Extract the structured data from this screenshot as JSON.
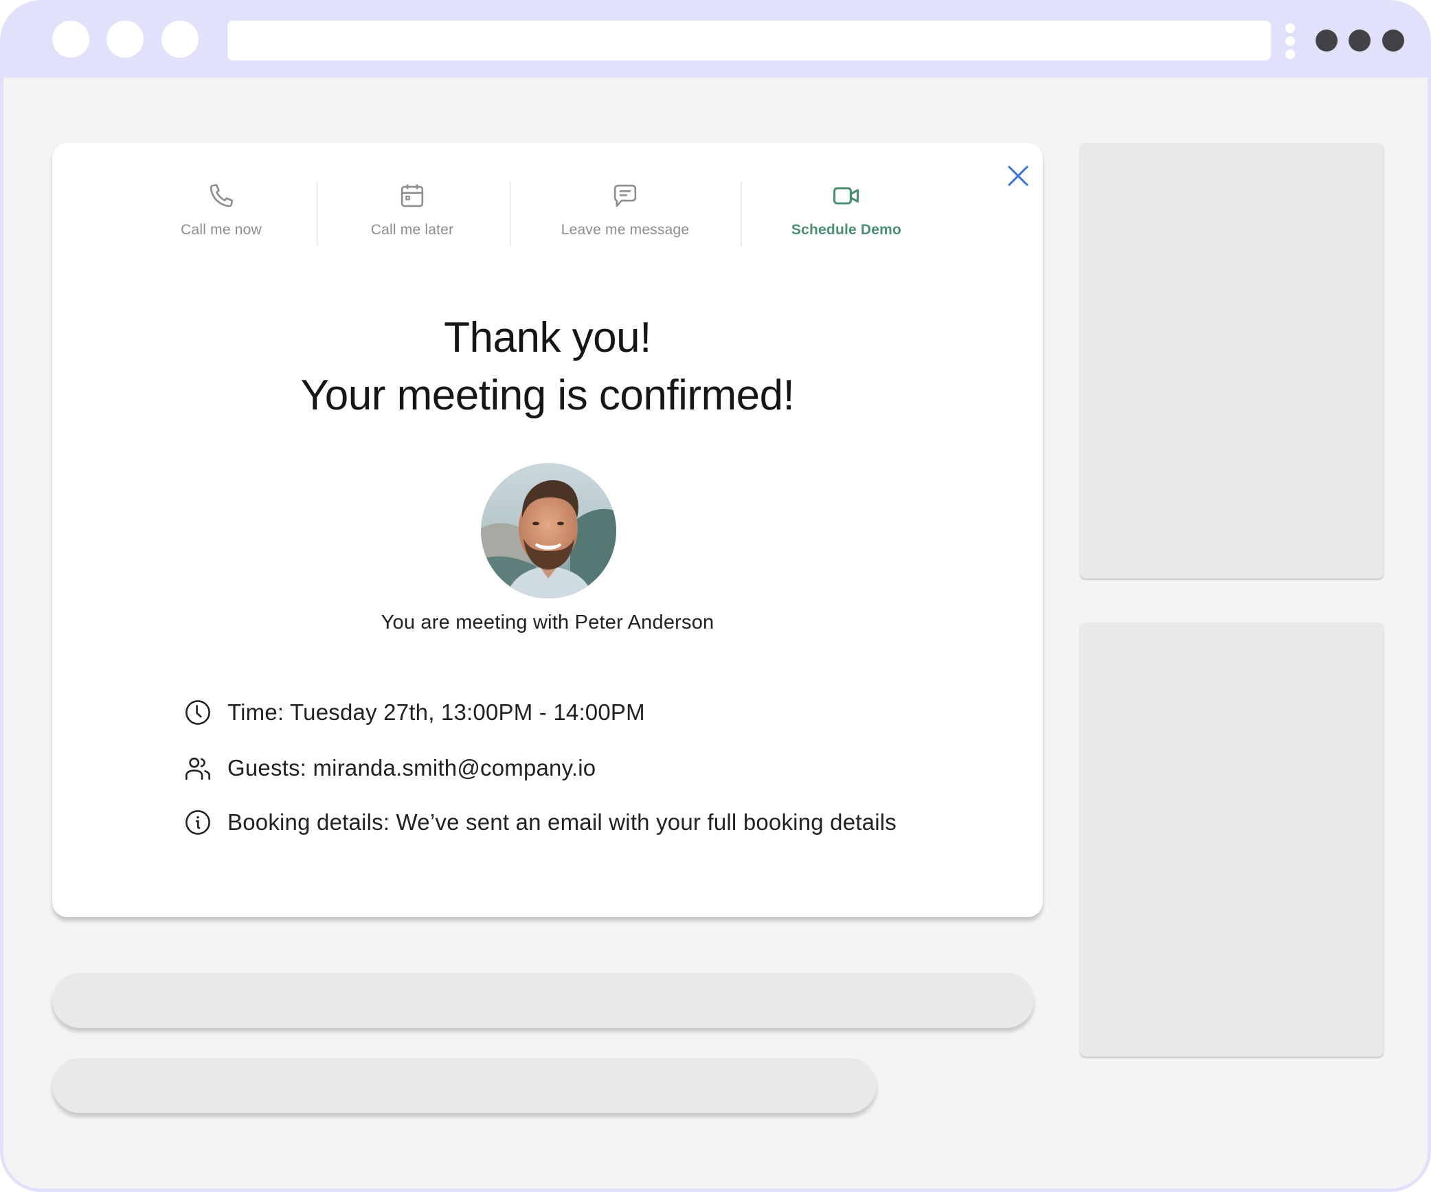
{
  "browser": {
    "window_controls": [
      "window-dot",
      "window-dot",
      "window-dot"
    ],
    "url_bar": {
      "value": "",
      "placeholder": ""
    },
    "menu_icon": "more-horizontal-icon",
    "kebab_icon": "more-vertical-icon"
  },
  "modal": {
    "close_icon": "close-icon",
    "tabs": [
      {
        "label": "Call me now",
        "icon": "phone-icon",
        "active": false
      },
      {
        "label": "Call me later",
        "icon": "calendar-icon",
        "active": false
      },
      {
        "label": "Leave me message",
        "icon": "message-icon",
        "active": false
      },
      {
        "label": "Schedule Demo",
        "icon": "video-camera-icon",
        "active": true
      }
    ],
    "title_line1": "Thank you!",
    "title_line2": "Your meeting is confirmed!",
    "host": {
      "avatar_alt": "Peter Anderson",
      "meeting_with_text": "You are meeting with Peter Anderson"
    },
    "details": [
      {
        "icon": "clock-icon",
        "text": "Time: Tuesday 27th, 13:00PM - 14:00PM"
      },
      {
        "icon": "guests-icon",
        "text": "Guests: miranda.smith@company.io"
      },
      {
        "icon": "info-icon",
        "text": "Booking details: We’ve sent an email with your full booking details"
      }
    ]
  },
  "colors": {
    "frame": "#e2e1fc",
    "page_background": "#f5f4f4",
    "active_tab": "#4a9070",
    "inactive_tab": "#8d8d8d",
    "close_icon": "#3a72d6",
    "placeholder_block": "#e9e9e9",
    "menu_dots": "#434347"
  }
}
